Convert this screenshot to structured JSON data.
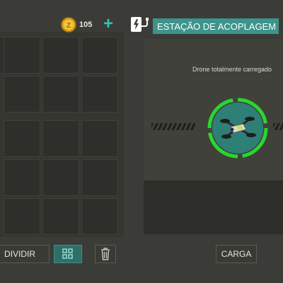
{
  "topbar": {
    "coins": "105",
    "add_icon": "plus-icon",
    "coin_icon": "coin-icon"
  },
  "dock": {
    "title": "ESTAÇÃO DE ACOPLAGEM",
    "status": "Drone totalmente carregado",
    "charge_level": 1.0,
    "accent_color": "#29d62f",
    "title_color": "#3d948c"
  },
  "buttons": {
    "divide": "DIVIDIR",
    "grid_icon": "grid-icon",
    "trash_icon": "trash-icon",
    "cargo": "CARGA"
  }
}
